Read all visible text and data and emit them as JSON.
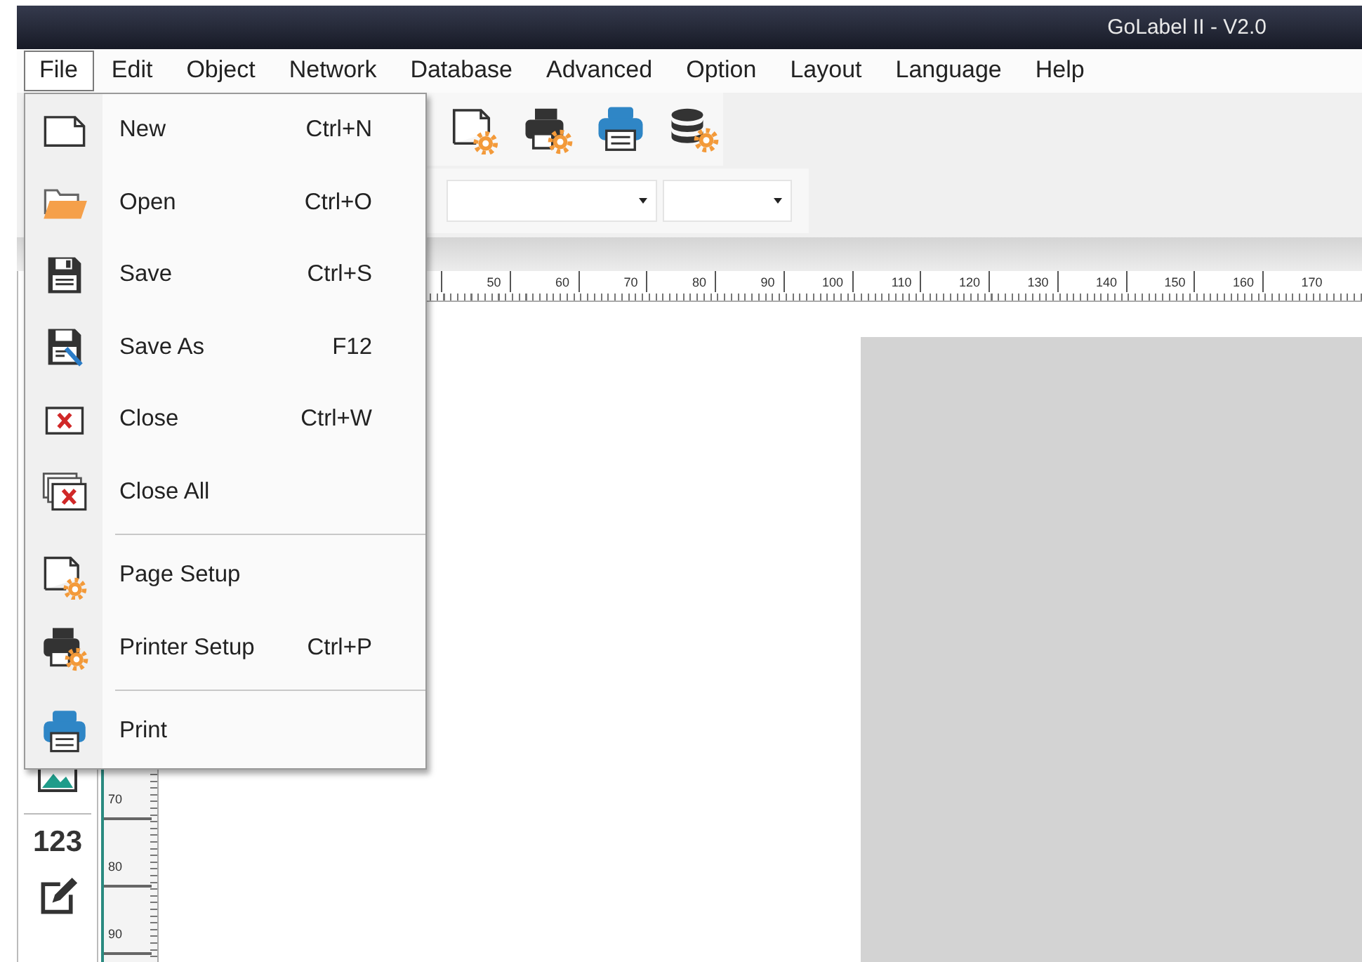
{
  "window": {
    "title": "GoLabel II - V2.0"
  },
  "menu_bar": [
    {
      "label": "File",
      "selected": true
    },
    {
      "label": "Edit",
      "selected": false
    },
    {
      "label": "Object",
      "selected": false
    },
    {
      "label": "Network",
      "selected": false
    },
    {
      "label": "Database",
      "selected": false
    },
    {
      "label": "Advanced",
      "selected": false
    },
    {
      "label": "Option",
      "selected": false
    },
    {
      "label": "Layout",
      "selected": false
    },
    {
      "label": "Language",
      "selected": false
    },
    {
      "label": "Help",
      "selected": false
    }
  ],
  "file_menu": [
    {
      "kind": "item",
      "label": "New",
      "shortcut": "Ctrl+N"
    },
    {
      "kind": "item",
      "label": "Open",
      "shortcut": "Ctrl+O"
    },
    {
      "kind": "item",
      "label": "Save",
      "shortcut": "Ctrl+S"
    },
    {
      "kind": "item",
      "label": "Save As",
      "shortcut": "F12"
    },
    {
      "kind": "item",
      "label": "Close",
      "shortcut": "Ctrl+W"
    },
    {
      "kind": "item",
      "label": "Close All"
    },
    {
      "kind": "separator"
    },
    {
      "kind": "item",
      "label": "Page Setup"
    },
    {
      "kind": "item",
      "label": "Printer Setup",
      "shortcut": "Ctrl+P"
    },
    {
      "kind": "separator"
    },
    {
      "kind": "item",
      "label": "Print"
    }
  ],
  "object_tools": {
    "number_tool": "123"
  },
  "horizontal_ruler": {
    "labels": [
      "50",
      "60",
      "70",
      "80",
      "90",
      "100",
      "110",
      "120",
      "130",
      "140",
      "150",
      "160",
      "170"
    ]
  },
  "vertical_ruler": {
    "labels": [
      "70",
      "80",
      "90"
    ]
  }
}
